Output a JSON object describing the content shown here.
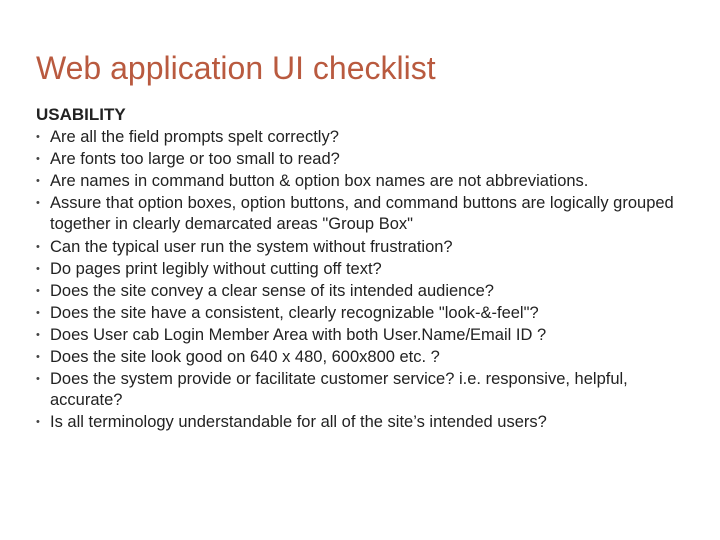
{
  "title": "Web application UI checklist",
  "section": "USABILITY",
  "items": [
    "Are all the field prompts spelt correctly?",
    "Are fonts too large or too small to read?",
    "Are names in command button & option box names are not abbreviations.",
    "Assure that option boxes, option buttons, and command buttons are logically grouped together in clearly demarcated areas \"Group Box\"",
    "Can the typical user run the system without frustration?",
    "Do pages print legibly without cutting off text?",
    "Does the site convey a clear sense of its intended audience?",
    "Does the site have a consistent, clearly recognizable \"look-&-feel\"?",
    "Does User cab Login Member Area with both User.Name/Email ID ?",
    "Does the site look good on 640 x 480, 600x800 etc. ?",
    "Does the system provide or facilitate customer service? i.e. responsive, helpful, accurate?",
    "Is all terminology understandable for all of the site’s intended users?"
  ]
}
